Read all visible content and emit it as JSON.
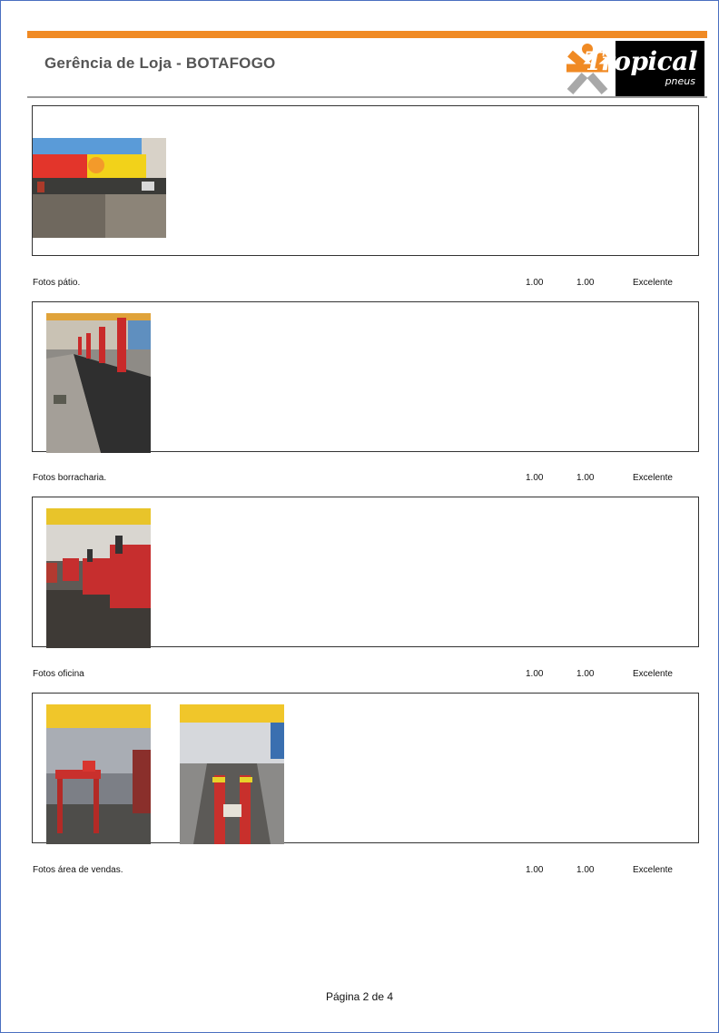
{
  "header": {
    "title": "Gerência de Loja - BOTAFOGO",
    "logo_text": "Tropical",
    "logo_subtext": "pneus",
    "accent_color": "#f08a24"
  },
  "sections": [
    {
      "label": "Fotos pátio.",
      "value1": "1.00",
      "value2": "1.00",
      "rating": "Excelente"
    },
    {
      "label": "Fotos borracharia.",
      "value1": "1.00",
      "value2": "1.00",
      "rating": "Excelente"
    },
    {
      "label": "Fotos oficina",
      "value1": "1.00",
      "value2": "1.00",
      "rating": "Excelente"
    },
    {
      "label": "Fotos área de vendas.",
      "value1": "1.00",
      "value2": "1.00",
      "rating": "Excelente"
    }
  ],
  "footer": {
    "page_label": "Página 2 de 4"
  }
}
